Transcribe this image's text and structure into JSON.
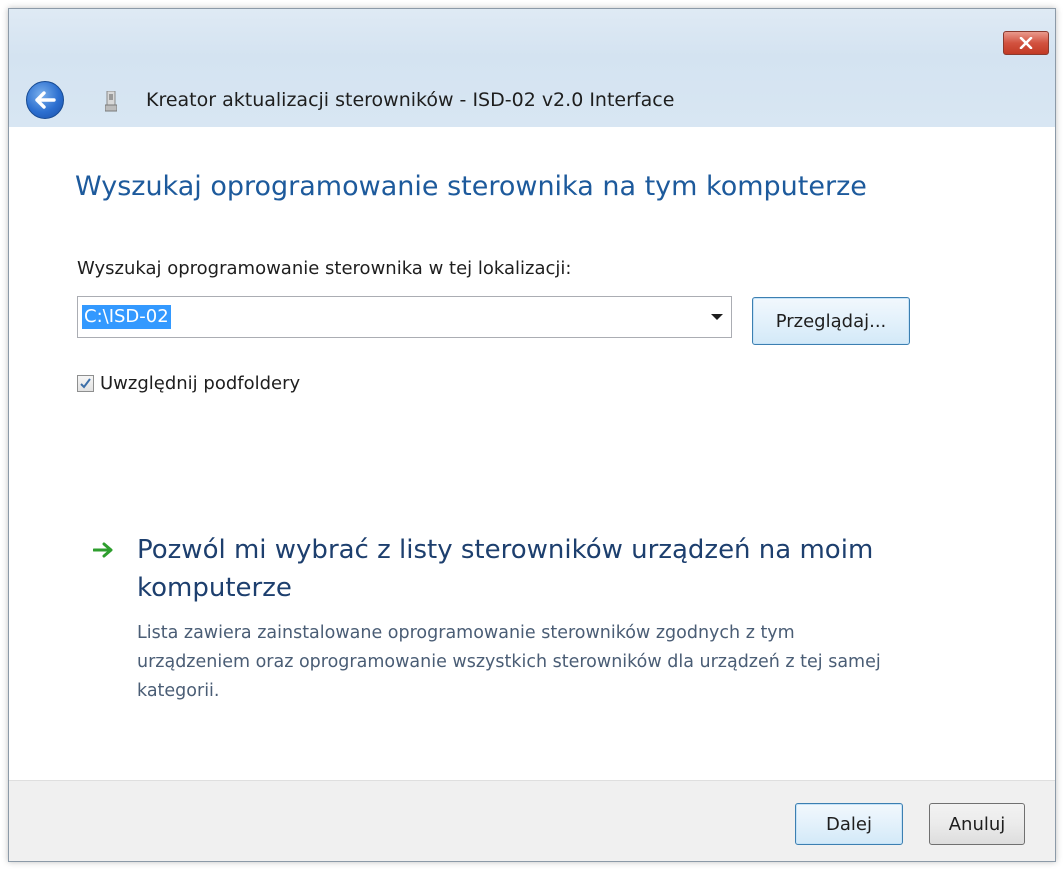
{
  "window": {
    "title": "Kreator aktualizacji sterowników - ISD-02 v2.0 Interface",
    "close_icon": "close-x-icon",
    "back_icon": "back-arrow-icon",
    "device_icon": "usb-device-icon"
  },
  "main": {
    "heading": "Wyszukaj oprogramowanie sterownika na tym komputerze",
    "location_label": "Wyszukaj oprogramowanie sterownika w tej lokalizacji:",
    "location_value": "C:\\ISD-02",
    "browse_label": "Przeglądaj...",
    "include_subfolders_label": "Uwzględnij podfoldery",
    "include_subfolders_checked": true,
    "pick_from_list": {
      "title": "Pozwól mi wybrać z listy sterowników urządzeń na moim komputerze",
      "description": "Lista zawiera zainstalowane oprogramowanie sterowników zgodnych z tym urządzeniem oraz oprogramowanie wszystkich sterowników dla urządzeń z tej samej kategorii.",
      "icon": "green-arrow-icon"
    }
  },
  "footer": {
    "next_label": "Dalej",
    "cancel_label": "Anuluj"
  },
  "colors": {
    "heading": "#1d5a9c",
    "selection": "#3399ff",
    "link_arrow": "#2e9e2e"
  }
}
